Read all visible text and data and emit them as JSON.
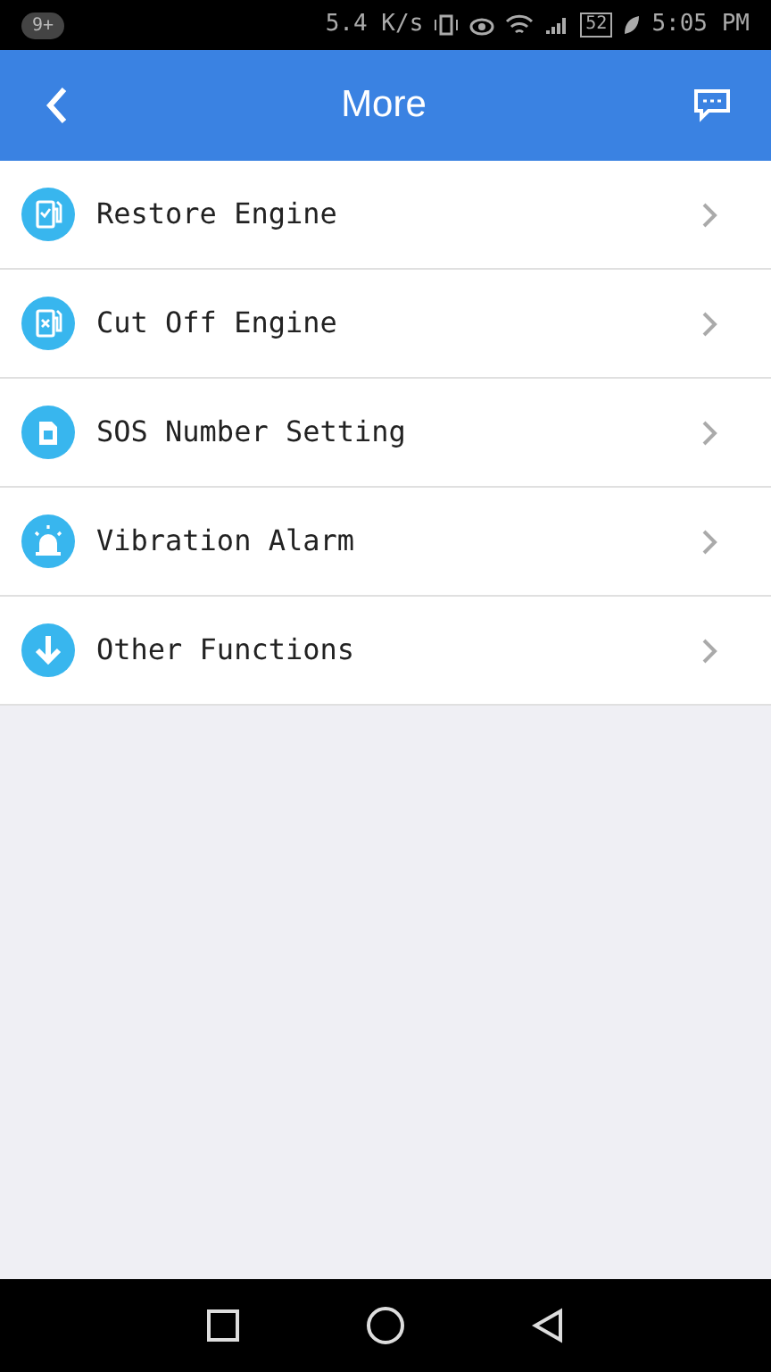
{
  "status_bar": {
    "notification_badge": "9+",
    "speed": "5.4 K/s",
    "battery": "52",
    "time": "5:05 PM"
  },
  "header": {
    "title": "More"
  },
  "menu": [
    {
      "label": "Restore Engine",
      "kind": "pump-check"
    },
    {
      "label": "Cut Off Engine",
      "kind": "pump-cross"
    },
    {
      "label": "SOS Number Setting",
      "kind": "sim"
    },
    {
      "label": "Vibration Alarm",
      "kind": "siren"
    },
    {
      "label": "Other Functions",
      "kind": "down"
    }
  ]
}
